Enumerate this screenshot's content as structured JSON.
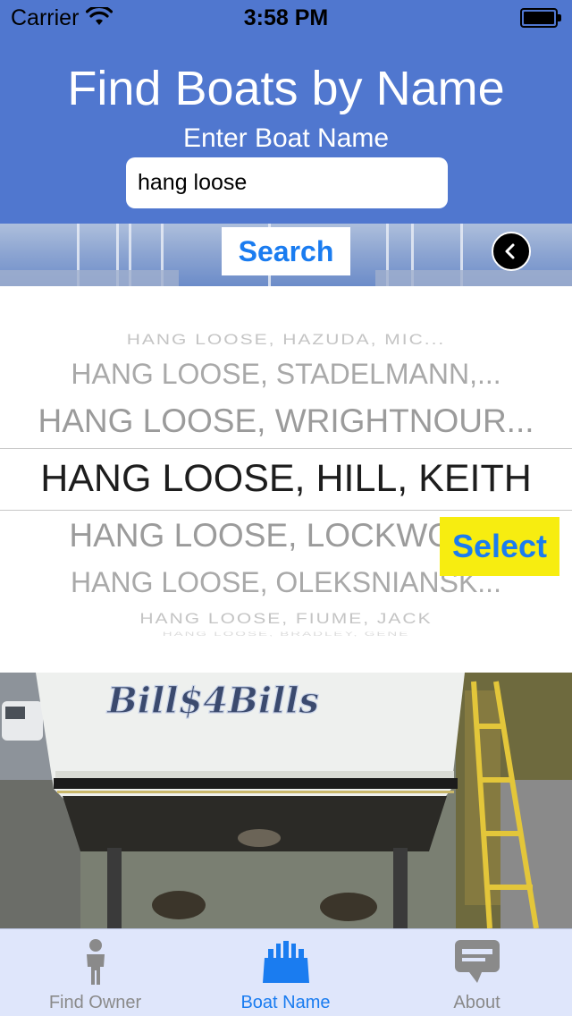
{
  "status_bar": {
    "carrier": "Carrier",
    "time": "3:58 PM"
  },
  "header": {
    "title": "Find Boats by Name",
    "field_label": "Enter Boat Name",
    "search_value": "hang loose",
    "search_button": "Search"
  },
  "picker": {
    "rows": [
      "HANG LOOSE, HAZUDA, MIC...",
      "HANG LOOSE, STADELMANN,...",
      "HANG LOOSE, WRIGHTNOUR...",
      "HANG LOOSE, HILL, KEITH",
      "HANG LOOSE, LOCKWOOD",
      "HANG LOOSE, OLEKSNIANSK...",
      "HANG LOOSE, FIUME, JACK",
      "HANG LOOSE, BRADLEY, GENE"
    ],
    "selected_index": 3,
    "select_button": "Select"
  },
  "photo": {
    "boat_lettering": "Bill$4Bills"
  },
  "tab_bar": {
    "tabs": [
      {
        "label": "Find Owner",
        "icon": "person-icon"
      },
      {
        "label": "Boat Name",
        "icon": "boat-name-icon"
      },
      {
        "label": "About",
        "icon": "speech-bubble-icon"
      }
    ],
    "active_index": 1
  },
  "colors": {
    "header_blue": "#5077cf",
    "accent_blue": "#1a7cf0",
    "select_yellow": "#f7ed10",
    "tab_bar_bg": "#dfe6fb"
  }
}
